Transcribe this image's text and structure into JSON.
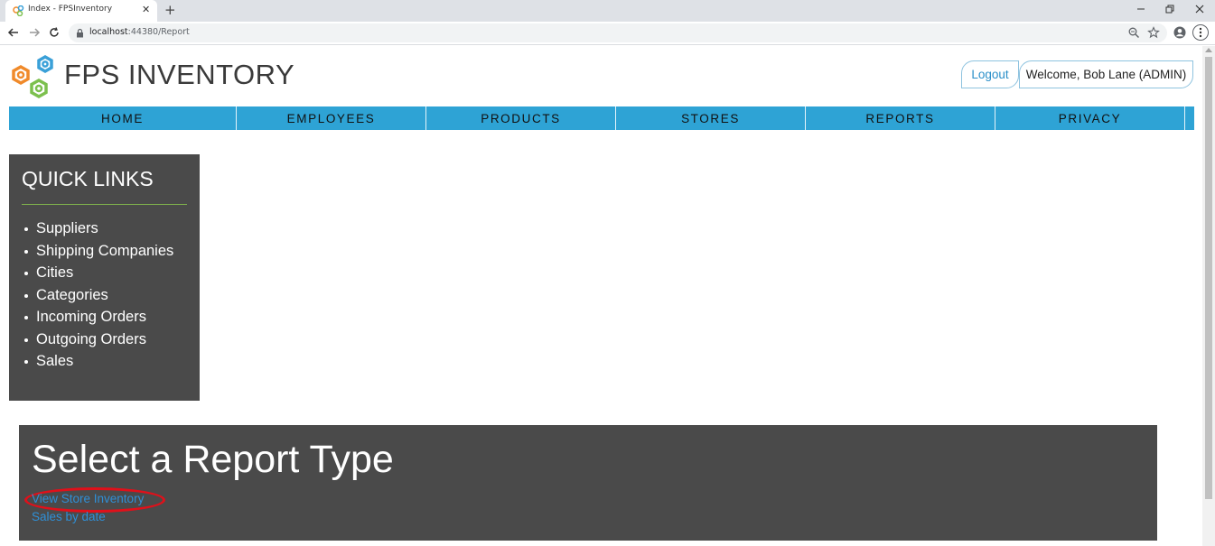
{
  "browser": {
    "tab_title": "Index - FPSInventory",
    "url_host": "localhost",
    "url_path": ":44380/Report"
  },
  "header": {
    "brand": "FPS INVENTORY",
    "logout_label": "Logout",
    "welcome_text": "Welcome, Bob Lane (ADMIN)"
  },
  "nav": {
    "items": [
      {
        "label": "HOME"
      },
      {
        "label": "EMPLOYEES"
      },
      {
        "label": "PRODUCTS"
      },
      {
        "label": "STORES"
      },
      {
        "label": "REPORTS"
      },
      {
        "label": "PRIVACY"
      }
    ]
  },
  "quick_links": {
    "title": "QUICK LINKS",
    "items": [
      {
        "label": "Suppliers"
      },
      {
        "label": "Shipping Companies"
      },
      {
        "label": "Cities"
      },
      {
        "label": "Categories"
      },
      {
        "label": "Incoming Orders"
      },
      {
        "label": "Outgoing Orders"
      },
      {
        "label": "Sales"
      }
    ]
  },
  "report": {
    "title": "Select a Report Type",
    "links": [
      {
        "label": "View Store Inventory"
      },
      {
        "label": "Sales by date"
      }
    ]
  },
  "colors": {
    "nav_bg": "#2ea3d5",
    "panel_bg": "#4a4a4a",
    "link": "#2f8fd6",
    "accent_rule": "#7fb24c",
    "annotation": "#e0101a"
  }
}
